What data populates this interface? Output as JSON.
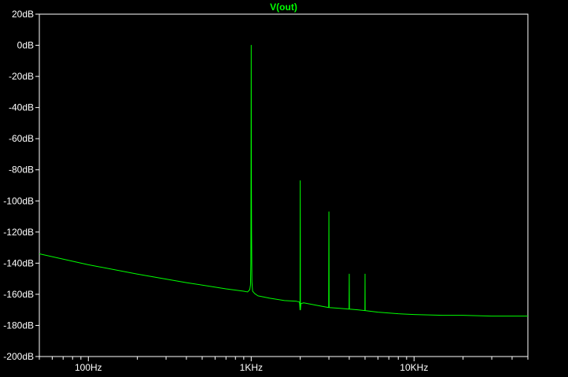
{
  "chart_data": {
    "type": "line",
    "title": "V(out)",
    "xlabel": "",
    "ylabel": "",
    "xscale": "log",
    "xlim": [
      50,
      50000
    ],
    "ylim": [
      -200,
      20
    ],
    "grid": false,
    "x_ticks": [
      {
        "value": 100,
        "label": "100Hz"
      },
      {
        "value": 1000,
        "label": "1KHz"
      },
      {
        "value": 10000,
        "label": "10KHz"
      }
    ],
    "y_ticks": [
      {
        "value": 20,
        "label": "20dB"
      },
      {
        "value": 0,
        "label": "0dB"
      },
      {
        "value": -20,
        "label": "-20dB"
      },
      {
        "value": -40,
        "label": "-40dB"
      },
      {
        "value": -60,
        "label": "-60dB"
      },
      {
        "value": -80,
        "label": "-80dB"
      },
      {
        "value": -100,
        "label": "-100dB"
      },
      {
        "value": -120,
        "label": "-120dB"
      },
      {
        "value": -140,
        "label": "-140dB"
      },
      {
        "value": -160,
        "label": "-160dB"
      },
      {
        "value": -180,
        "label": "-180dB"
      },
      {
        "value": -200,
        "label": "-200dB"
      }
    ],
    "series": [
      {
        "name": "V(out)",
        "color": "#00ff00",
        "x": [
          50,
          100,
          200,
          400,
          700,
          900,
          950,
          980,
          990,
          995,
          998,
          1000,
          1002,
          1005,
          1010,
          1020,
          1050,
          1100,
          1300,
          1600,
          1900,
          1980,
          1995,
          2000,
          2005,
          2020,
          2100,
          2500,
          2990,
          3000,
          3010,
          3500,
          3990,
          4000,
          4010,
          4500,
          4990,
          5000,
          5010,
          6000,
          8000,
          10000,
          15000,
          20000,
          30000,
          50000
        ],
        "y": [
          -134,
          -141,
          -147,
          -152.5,
          -156.5,
          -158,
          -158.5,
          -157,
          -154,
          -140,
          -75,
          0,
          -75,
          -120,
          -152,
          -158,
          -159.5,
          -161,
          -162.5,
          -164,
          -164.5,
          -165,
          -170,
          -87,
          -170,
          -166,
          -165.5,
          -167,
          -168.5,
          -107,
          -168.5,
          -169,
          -169.5,
          -147,
          -169.5,
          -170,
          -170.5,
          -147,
          -170.5,
          -171.5,
          -172.5,
          -173,
          -173.5,
          -173.5,
          -174,
          -174
        ]
      }
    ]
  }
}
